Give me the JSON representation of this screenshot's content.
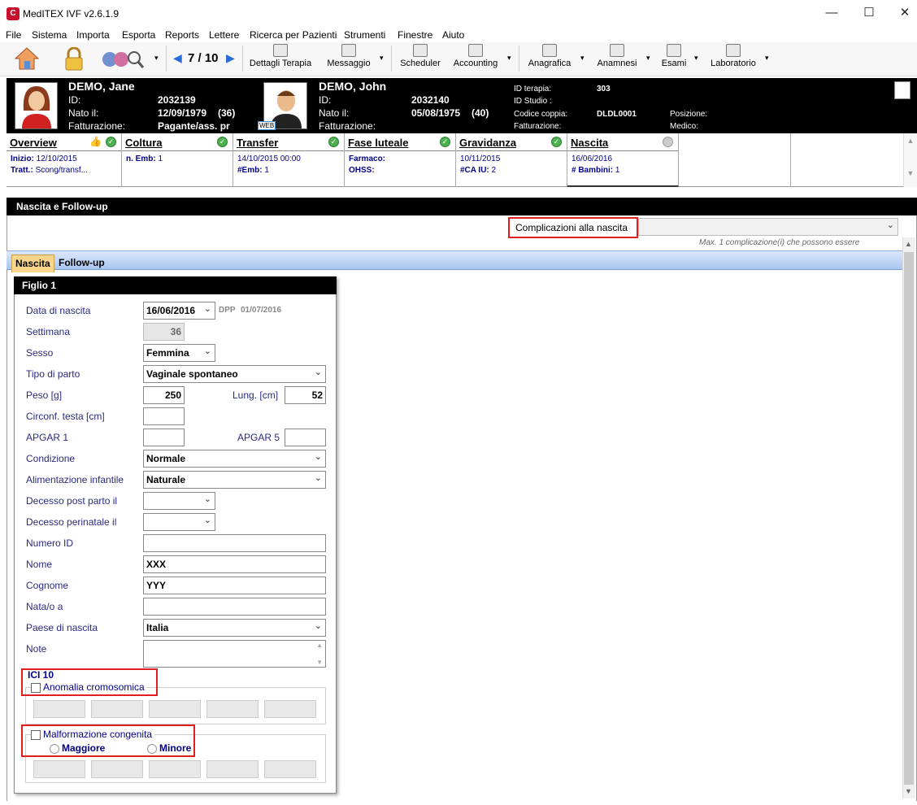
{
  "window": {
    "title": "MedITEX IVF v2.6.1.9",
    "logo": "C",
    "min": "—",
    "max": "☐",
    "close": "✕"
  },
  "menu": [
    "File",
    "Sistema",
    "Importa",
    "Esporta",
    "Reports",
    "Lettere",
    "Ricerca per Pazienti",
    "Strumenti",
    "Finestre",
    "Aiuto"
  ],
  "toolbar": {
    "nav_counter": "7 / 10",
    "prev": "◀",
    "next": "▶",
    "dropdown": "▾",
    "buttons": [
      "Dettagli Terapia",
      "Messaggio",
      "Scheduler",
      "Accounting",
      "Anagrafica",
      "Anamnesi",
      "Esami",
      "Laboratorio"
    ]
  },
  "patient": {
    "female": {
      "name": "DEMO, Jane",
      "id_label": "ID:",
      "id": "2032139",
      "born_label": "Nato il:",
      "born": "12/09/1979",
      "age": "(36)",
      "billing_label": "Fatturazione:",
      "billing": "Pagante/ass. pr"
    },
    "male": {
      "name": "DEMO, John",
      "id_label": "ID:",
      "id": "2032140",
      "born_label": "Nato il:",
      "born": "05/08/1975",
      "age": "(40)",
      "billing_label": "Fatturazione:",
      "badge": "WEB"
    },
    "therapy": {
      "id_label": "ID terapia:",
      "id": "303",
      "study_label": "ID Studio :",
      "couple_label": "Codice coppia:",
      "couple": "DLDL0001",
      "billing_label": "Fatturazione:",
      "position_label": "Posizione:",
      "doctor_label": "Medico:"
    }
  },
  "stages": [
    {
      "title": "Overview",
      "l1_label": "Inizio:",
      "l1": "12/10/2015",
      "l2_label": "Tratt.:",
      "l2": "Scong/transf..."
    },
    {
      "title": "Coltura",
      "l1_label": "n. Emb:",
      "l1": "1"
    },
    {
      "title": "Transfer",
      "l1": "14/10/2015 00:00",
      "l2_label": "#Emb:",
      "l2": "1"
    },
    {
      "title": "Fase luteale",
      "l1_label": "Farmaco:",
      "l2_label": "OHSS:"
    },
    {
      "title": "Gravidanza",
      "l1": "10/11/2015",
      "l2_label": "#CA IU:",
      "l2": "2"
    },
    {
      "title": "Nascita",
      "l1": "16/06/2016",
      "l2_label": "# Bambini:",
      "l2": "1"
    }
  ],
  "section_title": "Nascita e Follow-up",
  "complications": {
    "label": "Complicazioni alla nascita",
    "note": "Max. 1 complicazione(i) che possono essere"
  },
  "tabs": [
    "Nascita",
    "Follow-up"
  ],
  "child": {
    "header": "Figlio 1",
    "labels": {
      "birth_date": "Data di nascita",
      "week": "Settimana",
      "sex": "Sesso",
      "delivery": "Tipo di parto",
      "weight": "Peso [g]",
      "length": "Lung. [cm]",
      "head": "Circonf. testa [cm]",
      "apgar1": "APGAR 1",
      "apgar5": "APGAR 5",
      "condition": "Condizione",
      "feeding": "Alimentazione infantile",
      "death_post": "Decesso post parto il",
      "death_peri": "Decesso perinatale il",
      "number_id": "Numero ID",
      "first_name": "Nome",
      "last_name": "Cognome",
      "born_in": "Nata/o a",
      "country": "Paese di nascita",
      "notes": "Note"
    },
    "values": {
      "birth_date": "16/06/2016",
      "dpp_label": "DPP",
      "dpp": "01/07/2016",
      "week": "36",
      "sex": "Femmina",
      "delivery": "Vaginale spontaneo",
      "weight": "250",
      "length": "52",
      "condition": "Normale",
      "feeding": "Naturale",
      "first_name": "XXX",
      "last_name": "YYY",
      "country": "Italia"
    },
    "icd": {
      "title": "ICI 10",
      "chrom": "Anomalia cromosomica",
      "malf": "Malformazione congenita",
      "major": "Maggiore",
      "minor": "Minore"
    }
  }
}
